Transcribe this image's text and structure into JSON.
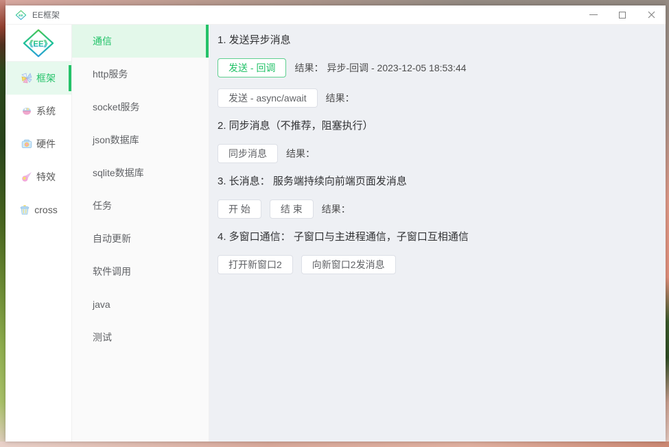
{
  "colors": {
    "accent_green": "#23c268",
    "selected_item_bg": "#e6f8ee",
    "main_bg": "#eef0f4",
    "sub_sidebar_bg": "#fafafa",
    "button_border": "#dcdfe6",
    "button_text": "#606266",
    "title_text": "#303133"
  },
  "titlebar": {
    "app_title": "EE框架",
    "logo_text": "《EE》"
  },
  "sidebar_main": {
    "items": [
      {
        "label": "框架",
        "icon": "pinwheel-icon",
        "selected": true
      },
      {
        "label": "系统",
        "icon": "basket-eggs-icon",
        "selected": false
      },
      {
        "label": "硬件",
        "icon": "camera-icon",
        "selected": false
      },
      {
        "label": "特效",
        "icon": "comet-icon",
        "selected": false
      },
      {
        "label": "cross",
        "icon": "bin-icon",
        "selected": false
      }
    ]
  },
  "sidebar_sub": {
    "items": [
      {
        "label": "通信",
        "selected": true
      },
      {
        "label": "http服务",
        "selected": false
      },
      {
        "label": "socket服务",
        "selected": false
      },
      {
        "label": "json数据库",
        "selected": false
      },
      {
        "label": "sqlite数据库",
        "selected": false
      },
      {
        "label": "任务",
        "selected": false
      },
      {
        "label": "自动更新",
        "selected": false
      },
      {
        "label": "软件调用",
        "selected": false
      },
      {
        "label": "java",
        "selected": false
      },
      {
        "label": "测试",
        "selected": false
      }
    ]
  },
  "content": {
    "sections": [
      {
        "title": "1. 发送异步消息",
        "rows": [
          {
            "buttons": [
              {
                "label": "发送 - 回调",
                "style": "success"
              }
            ],
            "result_label": "结果：",
            "result_value": "异步-回调 - 2023-12-05 18:53:44"
          },
          {
            "buttons": [
              {
                "label": "发送 - async/await",
                "style": "default"
              }
            ],
            "result_label": "结果：",
            "result_value": ""
          }
        ]
      },
      {
        "title": "2. 同步消息（不推荐，阻塞执行）",
        "rows": [
          {
            "buttons": [
              {
                "label": "同步消息",
                "style": "default"
              }
            ],
            "result_label": "结果：",
            "result_value": ""
          }
        ]
      },
      {
        "title": "3. 长消息： 服务端持续向前端页面发消息",
        "rows": [
          {
            "buttons": [
              {
                "label": "开 始",
                "style": "default"
              },
              {
                "label": "结 束",
                "style": "default"
              }
            ],
            "result_label": "结果：",
            "result_value": ""
          }
        ]
      },
      {
        "title": "4. 多窗口通信： 子窗口与主进程通信，子窗口互相通信",
        "rows": [
          {
            "buttons": [
              {
                "label": "打开新窗口2",
                "style": "default"
              },
              {
                "label": "向新窗口2发消息",
                "style": "default"
              }
            ],
            "result_label": "",
            "result_value": ""
          }
        ]
      }
    ]
  }
}
